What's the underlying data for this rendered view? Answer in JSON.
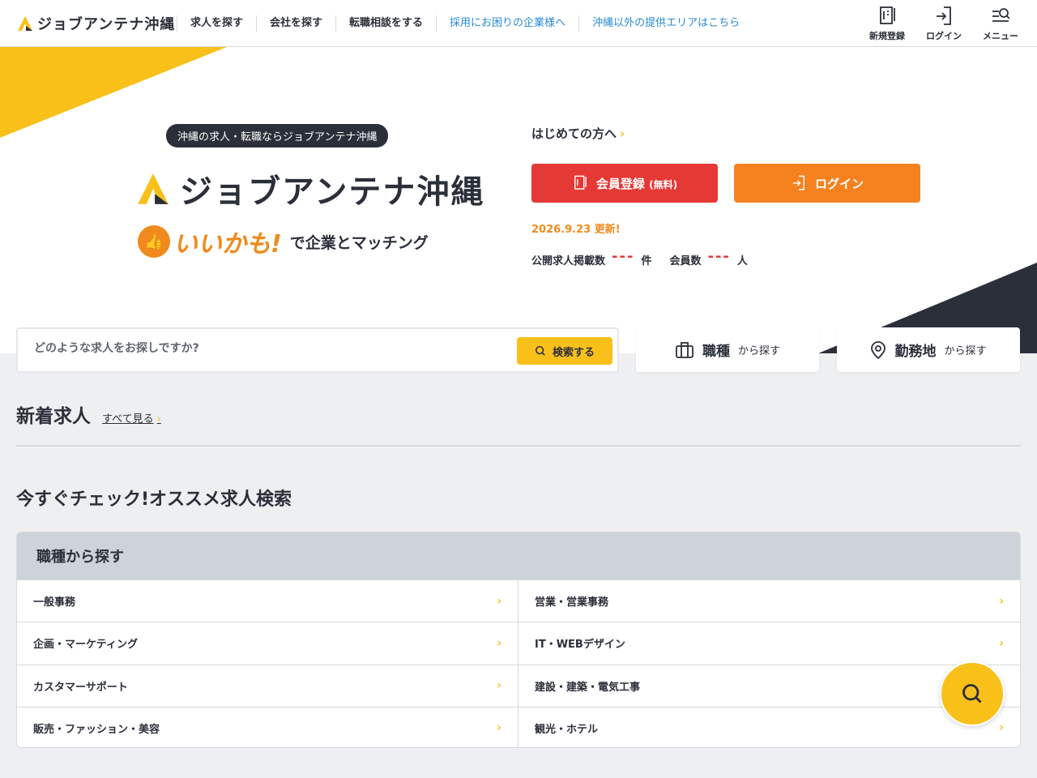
{
  "header": {
    "logo_text": "ジョブアンテナ沖縄",
    "nav": [
      {
        "label": "求人を探す"
      },
      {
        "label": "会社を探す"
      },
      {
        "label": "転職相談をする"
      },
      {
        "label": "採用にお困りの企業様へ"
      },
      {
        "label": "沖縄以外の提供エリアはこちら"
      }
    ],
    "icons": [
      {
        "label": "新規登録",
        "icon": "register-icon"
      },
      {
        "label": "ログイン",
        "icon": "login-icon"
      },
      {
        "label": "メニュー",
        "icon": "menu-search-icon"
      }
    ]
  },
  "hero": {
    "pill": "沖縄の求人・転職ならジョブアンテナ沖縄",
    "logo_text": "ジョブアンテナ沖縄",
    "tag_iikamo": "いいかも!",
    "tag_rest": "で企業とマッチング",
    "first_link": "はじめての方へ",
    "register_label": "会員登録",
    "register_sub": "(無料)",
    "login_label": "ログイン",
    "update_date": "2026.9.23",
    "update_suffix": "更新!",
    "jobs_label": "公開求人掲載数",
    "jobs_value": "---",
    "jobs_unit": "件",
    "members_label": "会員数",
    "members_value": "---",
    "members_unit": "人"
  },
  "search": {
    "placeholder": "どのような求人をお探しですか?",
    "button": "検索する",
    "tab_occupation_big": "職種",
    "tab_occupation_small": "から探す",
    "tab_location_big": "勤務地",
    "tab_location_small": "から探す"
  },
  "new_jobs": {
    "title": "新着求人",
    "see_all": "すべて見る"
  },
  "recommend": {
    "title": "今すぐチェック!オススメ求人検索",
    "box_title": "職種から探す",
    "items": [
      {
        "label": "一般事務"
      },
      {
        "label": "営業・営業事務"
      },
      {
        "label": "企画・マーケティング"
      },
      {
        "label": "IT・WEBデザイン"
      },
      {
        "label": "カスタマーサポート"
      },
      {
        "label": "建設・建築・電気工事"
      },
      {
        "label": "販売・ファッション・美容"
      },
      {
        "label": "観光・ホテル"
      }
    ]
  },
  "colors": {
    "yellow": "#f9c01a",
    "navy": "#2b2f3a",
    "red": "#e53935",
    "orange": "#f5821f",
    "link_blue": "#2a8ad1"
  }
}
